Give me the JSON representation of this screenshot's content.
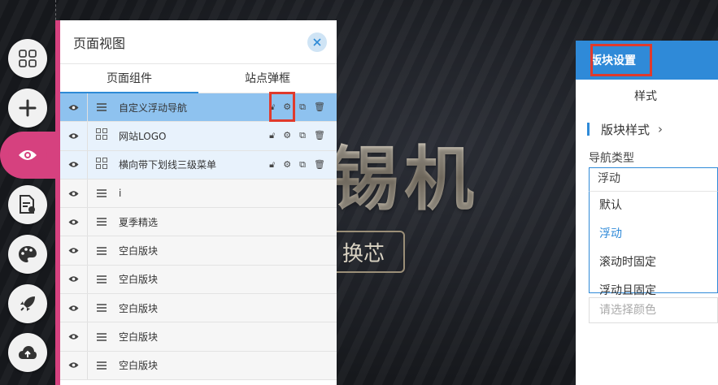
{
  "colors": {
    "accent": "#d6417f",
    "primary": "#2f8ad8",
    "highlight": "#e03a2c"
  },
  "hero": {
    "text": "锡机",
    "badge": "换芯"
  },
  "rail": [
    {
      "icon": "apps-grid-icon"
    },
    {
      "icon": "plus-icon"
    },
    {
      "icon": "eye-icon",
      "active": true
    },
    {
      "icon": "document-settings-icon"
    },
    {
      "icon": "palette-icon"
    },
    {
      "icon": "rocket-icon"
    },
    {
      "icon": "cloud-upload-icon"
    }
  ],
  "panel": {
    "title": "页面视图",
    "tabs": [
      "页面组件",
      "站点弹框"
    ],
    "rows": [
      {
        "label": "自定义浮动导航",
        "type": "menu",
        "state": "selected",
        "actions": true
      },
      {
        "label": "网站LOGO",
        "type": "grid",
        "state": "child",
        "actions": true
      },
      {
        "label": "横向带下划线三级菜单",
        "type": "grid",
        "state": "child",
        "actions": true
      },
      {
        "label": "i",
        "type": "menu"
      },
      {
        "label": "夏季精选",
        "type": "menu"
      },
      {
        "label": "空白版块",
        "type": "menu"
      },
      {
        "label": "空白版块",
        "type": "menu"
      },
      {
        "label": "空白版块",
        "type": "menu"
      },
      {
        "label": "空白版块",
        "type": "menu"
      },
      {
        "label": "空白版块",
        "type": "menu"
      }
    ]
  },
  "settings": {
    "title": "版块设置",
    "tab": "样式",
    "section": "版块样式",
    "nav_type_label": "导航类型",
    "nav_type_value": "浮动",
    "options": [
      "默认",
      "浮动",
      "滚动时固定",
      "浮动且固定"
    ],
    "selected_option": "浮动",
    "color_placeholder": "请选择颜色"
  }
}
